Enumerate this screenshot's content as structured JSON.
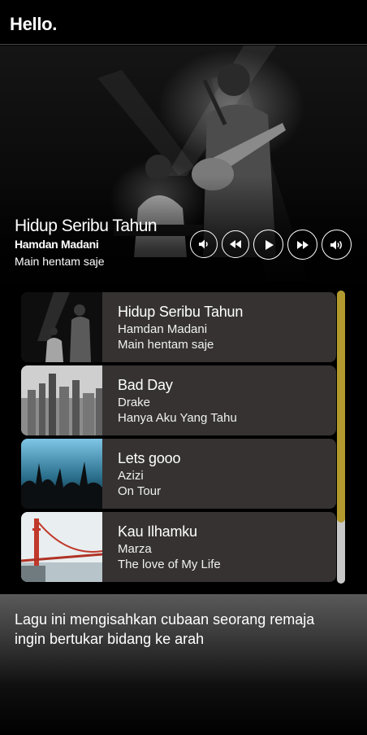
{
  "app": {
    "title": "Hello."
  },
  "now_playing": {
    "title": "Hidup Seribu Tahun",
    "artist": "Hamdan Madani",
    "album": "Main hentam saje"
  },
  "controls": [
    {
      "name": "volume-down",
      "icon": "volume-down-icon"
    },
    {
      "name": "rewind",
      "icon": "rewind-icon"
    },
    {
      "name": "play",
      "icon": "play-icon"
    },
    {
      "name": "fast-forward",
      "icon": "fast-forward-icon"
    },
    {
      "name": "volume-up",
      "icon": "volume-up-icon"
    }
  ],
  "tracks": [
    {
      "title": "Hidup Seribu Tahun",
      "artist": "Hamdan Madani",
      "album": "Main hentam saje"
    },
    {
      "title": "Bad Day",
      "artist": "Drake",
      "album": "Hanya Aku Yang Tahu"
    },
    {
      "title": "Lets gooo",
      "artist": "Azizi",
      "album": "On Tour"
    },
    {
      "title": "Kau Ilhamku",
      "artist": "Marza",
      "album": "The love of My Life"
    }
  ],
  "description": "Lagu ini mengisahkan cubaan seorang remaja ingin bertukar bidang ke arah",
  "colors": {
    "card_bg": "#363232",
    "scroll_thumb": "#b39a2e",
    "scroll_track": "#c8c8c8"
  }
}
